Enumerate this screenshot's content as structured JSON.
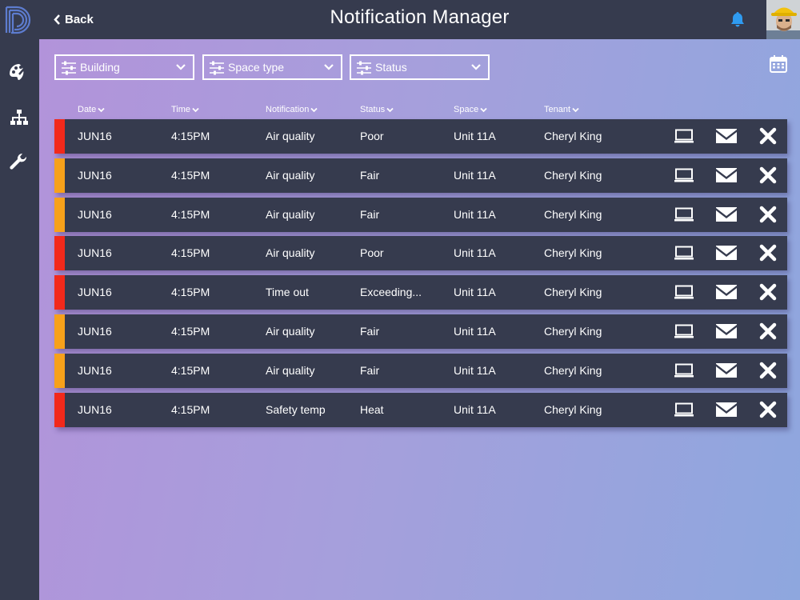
{
  "app": {
    "title": "Notification Manager",
    "back_label": "Back"
  },
  "colors": {
    "sidebar": "#363b4e",
    "row": "#363b4e",
    "accent_blue": "#2f9bf0",
    "severity_red": "#f2291b",
    "severity_orange": "#f7a11a",
    "gradient_start": "#b293da",
    "gradient_end": "#8ea7de"
  },
  "sidebar": {
    "items": [
      {
        "icon": "palette-icon"
      },
      {
        "icon": "sitemap-icon"
      },
      {
        "icon": "wrench-icon"
      }
    ]
  },
  "filters": [
    {
      "label": "Building",
      "icon": "sliders-icon"
    },
    {
      "label": "Space type",
      "icon": "sliders-icon"
    },
    {
      "label": "Status",
      "icon": "sliders-icon"
    }
  ],
  "columns": [
    "Date",
    "Time",
    "Notification",
    "Status",
    "Space",
    "Tenant"
  ],
  "rows": [
    {
      "severity": "red",
      "date": "JUN16",
      "time": "4:15PM",
      "notification": "Air quality",
      "status": "Poor",
      "space": "Unit 11A",
      "tenant": "Cheryl King"
    },
    {
      "severity": "orange",
      "date": "JUN16",
      "time": "4:15PM",
      "notification": "Air quality",
      "status": "Fair",
      "space": "Unit 11A",
      "tenant": "Cheryl King"
    },
    {
      "severity": "orange",
      "date": "JUN16",
      "time": "4:15PM",
      "notification": "Air quality",
      "status": "Fair",
      "space": "Unit 11A",
      "tenant": "Cheryl King"
    },
    {
      "severity": "red",
      "date": "JUN16",
      "time": "4:15PM",
      "notification": "Air quality",
      "status": "Poor",
      "space": "Unit 11A",
      "tenant": "Cheryl King"
    },
    {
      "severity": "red",
      "date": "JUN16",
      "time": "4:15PM",
      "notification": "Time out",
      "status": "Exceeding...",
      "space": "Unit 11A",
      "tenant": "Cheryl King"
    },
    {
      "severity": "orange",
      "date": "JUN16",
      "time": "4:15PM",
      "notification": "Air quality",
      "status": "Fair",
      "space": "Unit 11A",
      "tenant": "Cheryl King"
    },
    {
      "severity": "orange",
      "date": "JUN16",
      "time": "4:15PM",
      "notification": "Air quality",
      "status": "Fair",
      "space": "Unit 11A",
      "tenant": "Cheryl King"
    },
    {
      "severity": "red",
      "date": "JUN16",
      "time": "4:15PM",
      "notification": "Safety temp",
      "status": "Heat",
      "space": "Unit 11A",
      "tenant": "Cheryl King"
    }
  ],
  "row_actions": [
    "laptop-icon",
    "envelope-icon",
    "close-icon"
  ]
}
